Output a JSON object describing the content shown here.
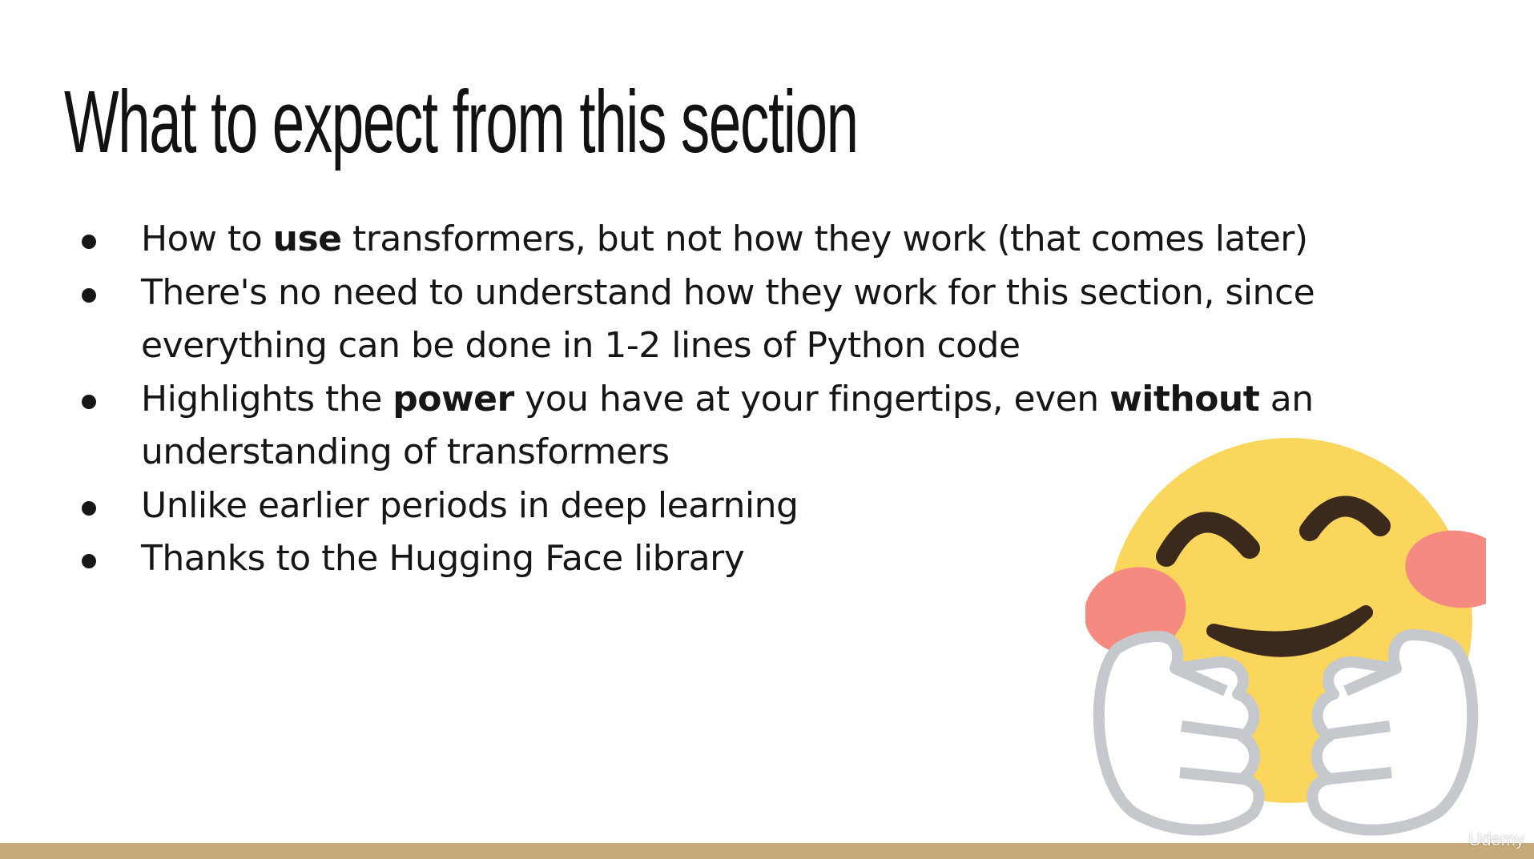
{
  "slide": {
    "title": "What to expect from this section",
    "bullets": [
      {
        "pre": "How to ",
        "bold1": "use",
        "mid": " transformers, but not how they work (that comes later)",
        "bold2": "",
        "post": ""
      },
      {
        "pre": "There's no need to understand how they work for this section, since everything can be done in 1-2 lines of Python code",
        "bold1": "",
        "mid": "",
        "bold2": "",
        "post": ""
      },
      {
        "pre": "Highlights the ",
        "bold1": "power",
        "mid": " you have at your fingertips, even ",
        "bold2": "without",
        "post": " an understanding of transformers"
      },
      {
        "pre": "Unlike earlier periods in deep learning",
        "bold1": "",
        "mid": "",
        "bold2": "",
        "post": ""
      },
      {
        "pre": "Thanks to the Hugging Face library",
        "bold1": "",
        "mid": "",
        "bold2": "",
        "post": ""
      }
    ],
    "illustration": "hugging-face-emoji",
    "watermark": "Udemy",
    "colors": {
      "text": "#141414",
      "emoji_face": "#fbd65d",
      "emoji_cheeks": "#f58a80",
      "emoji_features": "#3b2a1c",
      "bottom_bar": "#c8a979"
    }
  }
}
